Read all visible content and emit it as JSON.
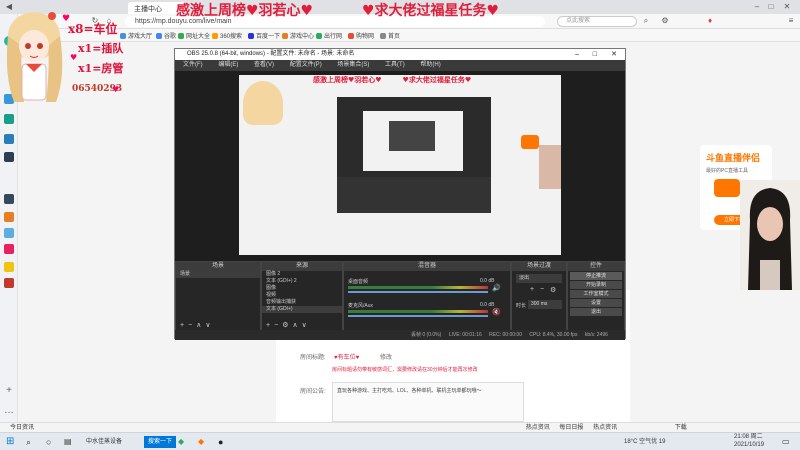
{
  "browser": {
    "tab_label": "主播中心",
    "url": "https://mp.douyu.com/live/main",
    "search_placeholder": "点此搜索",
    "bookmarks": [
      "游戏大厅",
      "谷歌",
      "网址大全",
      "360搜索",
      "百度一下",
      "游戏中心",
      "出行网",
      "购物网",
      "首页"
    ]
  },
  "overlay": {
    "banner_left": "感激上周榜♥羽若心♥",
    "banner_right": "♥求大佬过福星任务♥",
    "line1": "x8=车位",
    "line2": "x1=插队",
    "line3": "x1=房管",
    "room_id": "06540293"
  },
  "obs": {
    "title": "OBS 25.0.8 (64-bit, windows) - 配置文件: 未命名 - 场景: 未命名",
    "menu": [
      "文件(F)",
      "编辑(E)",
      "查看(V)",
      "配置文件(P)",
      "场景集合(S)",
      "工具(T)",
      "帮助(H)"
    ],
    "docks": {
      "scenes_title": "场景",
      "scenes": [
        "场景"
      ],
      "sources_title": "来源",
      "sources": [
        "图像 2",
        "文本 (GDI+) 2",
        "图像",
        "视频",
        "音频输出捕获",
        "文本 (GDI+)"
      ],
      "mixer_title": "混音器",
      "mixer": [
        {
          "name": "桌面音频",
          "level": "0.0 dB"
        },
        {
          "name": "麦克风/Aux",
          "level": "0.0 dB"
        }
      ],
      "transitions_title": "场景过渡",
      "transition_type": "淡出",
      "duration_label": "时长",
      "duration": "300 ms",
      "controls_title": "控件",
      "controls": [
        "停止推流",
        "开始录制",
        "工作室模式",
        "设置",
        "退出"
      ]
    },
    "status": {
      "dropped": "丢帧 0 (0.0%)",
      "live": "LIVE: 00:01:16",
      "rec": "REC: 00:00:00",
      "cpu": "CPU: 8.4%, 30.00 fps",
      "kbps": "kb/s: 2496"
    }
  },
  "page": {
    "room_title_label": "房间标题:",
    "room_title": "♥有车位♥",
    "edit_label": "修改",
    "warning": "房间标题请勿带有敏感词汇，需要修改请在30分钟后才能再次修改",
    "notice_label": "房间公告:",
    "notice_text": "直玩各种游戏、主打吃鸡、LOL、各种单机、联机主玩单都玩哦～"
  },
  "rank_widget": {
    "title": "斗鱼直播伴侣",
    "subtitle": "最好的PC直播工具",
    "button": "立即下载"
  },
  "bottom_status": {
    "left": "今日资讯",
    "items": [
      "热点资讯",
      "每日日报",
      "热点资讯"
    ],
    "download": "下载"
  },
  "taskbar": {
    "search_icon": "search-icon",
    "apps": [
      "中水佳蒸设备",
      "搜索一下"
    ],
    "weather": "18°C 空气优 19",
    "time": "21:08 周二",
    "date": "2021/10/19"
  },
  "colors": {
    "banner_red": "#e01e3c",
    "douyu_orange": "#ff7700",
    "obs_dark": "#2b2b2b"
  }
}
